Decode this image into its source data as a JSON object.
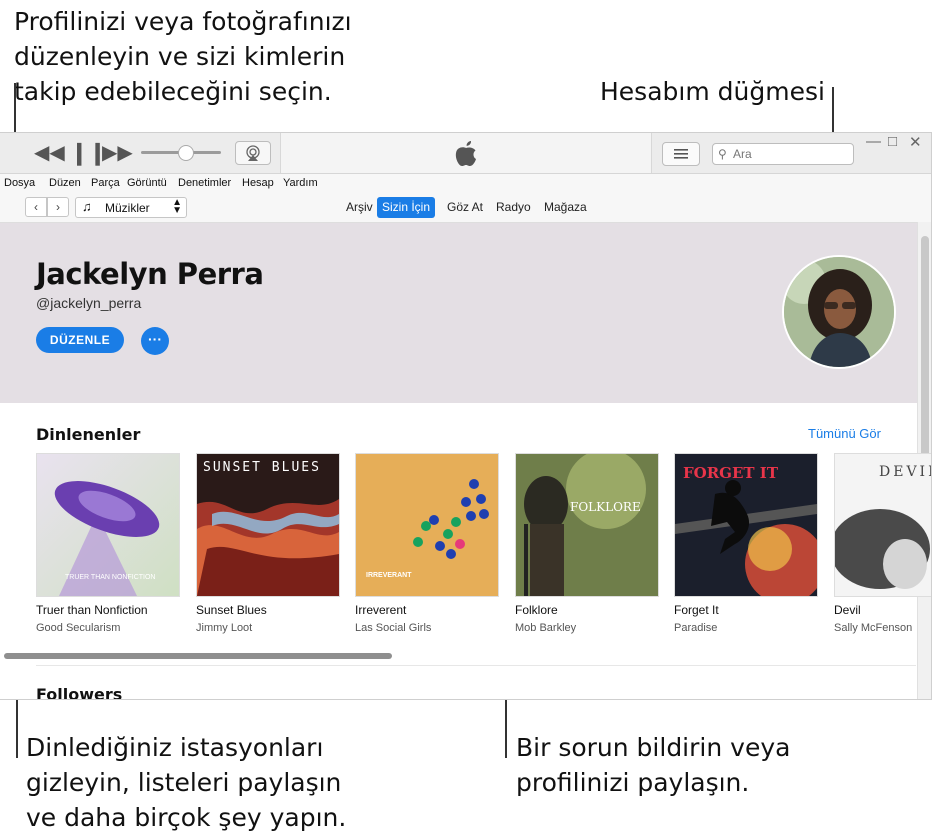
{
  "callouts": {
    "top_left": "Profilinizi veya fotoğrafınızı\ndüzenleyin ve sizi kimlerin\ntakip edebileceğini seçin.",
    "top_right": "Hesabım düğmesi",
    "bottom_left": "Dinlediğiniz istasyonları\ngizleyin, listeleri paylaşın\nve daha birçok şey yapın.",
    "bottom_right": "Bir sorun bildirin veya\nprofilinizi paylaşın."
  },
  "search": {
    "placeholder": "Ara"
  },
  "menu": [
    "Dosya",
    "Düzen",
    "Parça",
    "Görüntü",
    "Denetimler",
    "Hesap",
    "Yardım"
  ],
  "media_selector": "Müzikler",
  "tabs": [
    {
      "label": "Arşiv",
      "active": false
    },
    {
      "label": "Sizin İçin",
      "active": true
    },
    {
      "label": "Göz At",
      "active": false
    },
    {
      "label": "Radyo",
      "active": false
    },
    {
      "label": "Mağaza",
      "active": false
    }
  ],
  "profile": {
    "name": "Jackelyn Perra",
    "handle": "@jackelyn_perra",
    "edit_label": "DÜZENLE",
    "more_label": "···"
  },
  "section": {
    "title": "Dinlenenler",
    "see_all": "Tümünü Gör"
  },
  "albums": [
    {
      "title": "Truer than Nonfiction",
      "artist": "Good Secularism",
      "art_text": "TRUER THAN NONFICTION"
    },
    {
      "title": "Sunset Blues",
      "artist": "Jimmy Loot",
      "art_text": "SUNSET BLUES"
    },
    {
      "title": "Irreverent",
      "artist": "Las Social Girls",
      "art_text": "IRREVERANT"
    },
    {
      "title": "Folklore",
      "artist": "Mob Barkley",
      "art_text": "FOLKLORE"
    },
    {
      "title": "Forget It",
      "artist": "Paradise",
      "art_text": "FORGET IT"
    },
    {
      "title": "Devil",
      "artist": "Sally McFenson",
      "art_text": "DEVIL"
    }
  ],
  "followers_title": "Followers",
  "icons": [
    "rewind-icon",
    "pause-icon",
    "forward-icon",
    "airplay-icon",
    "apple-logo-icon",
    "list-icon",
    "search-icon",
    "minimize-icon",
    "maximize-icon",
    "close-icon",
    "back-icon",
    "forward-nav-icon",
    "music-note-icon",
    "chevron-updown-icon"
  ],
  "colors": {
    "accent": "#1a7de6",
    "profile_bg": "#e4dfe4"
  }
}
